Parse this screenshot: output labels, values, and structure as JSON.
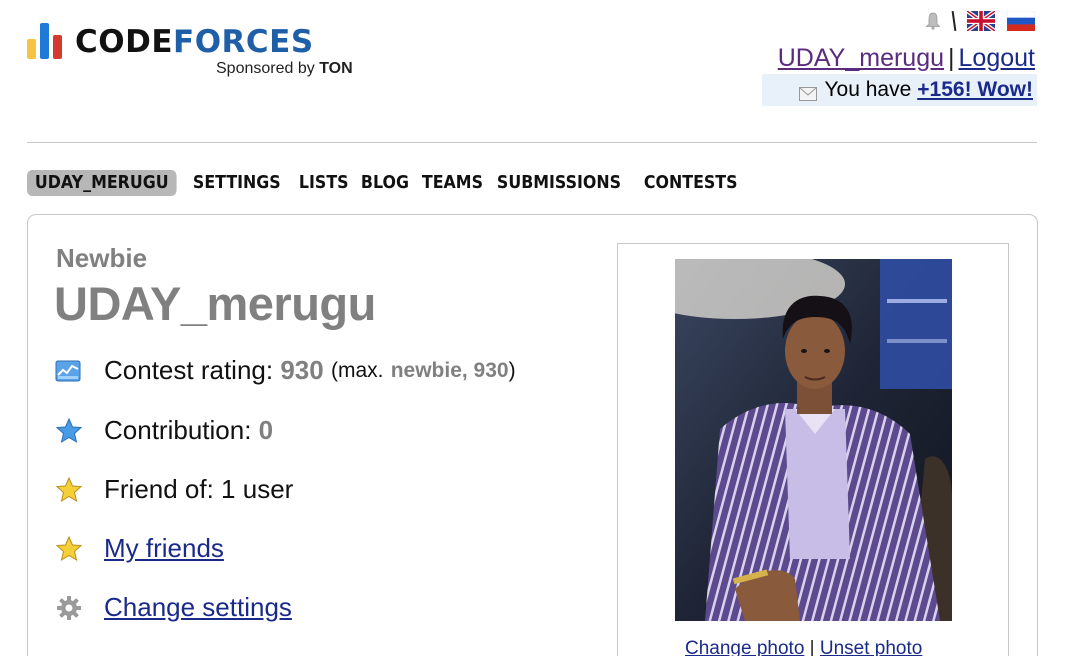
{
  "logo": {
    "title_code": "CODE",
    "title_forces": "FORCES",
    "sponsored_prefix": "Sponsored by",
    "sponsored_brand": "TON"
  },
  "header": {
    "username": "UDAY_merugu",
    "separator": "|",
    "logout": "Logout",
    "message_prefix": "You have",
    "message_count": "+156! Wow!"
  },
  "tabs": [
    {
      "label": "UDAY_MERUGU",
      "active": true
    },
    {
      "label": "SETTINGS",
      "active": false
    },
    {
      "label": "LISTS",
      "active": false
    },
    {
      "label": "BLOG",
      "active": false
    },
    {
      "label": "TEAMS",
      "active": false
    },
    {
      "label": "SUBMISSIONS",
      "active": false
    },
    {
      "label": "CONTESTS",
      "active": false
    }
  ],
  "profile": {
    "rank": "Newbie",
    "handle": "UDAY_merugu",
    "rating_label": "Contest rating:",
    "rating_value": "930",
    "rating_max_prefix": "(max.",
    "rating_max_rank": "newbie, 930",
    "rating_max_suffix": ")",
    "contribution_label": "Contribution:",
    "contribution_value": "0",
    "friend_of": "Friend of: 1 user",
    "my_friends": "My friends",
    "change_settings": "Change settings"
  },
  "photo": {
    "change_photo": "Change photo",
    "separator": "|",
    "unset_photo": "Unset photo"
  },
  "icons": {
    "notification": "bell-icon",
    "flag_en": "uk-flag-icon",
    "flag_ru": "russia-flag-icon",
    "message": "envelope-icon",
    "rating": "rating-chart-icon",
    "contribution": "blue-star-icon",
    "friend_of": "gold-star-icon",
    "my_friends": "gold-star-icon",
    "settings": "gear-icon"
  },
  "colors": {
    "rank_gray": "#808080",
    "link_blue": "#1a2a8a",
    "visited_purple": "#5a2b7e",
    "brand_blue": "#1f5fa8",
    "logo_yellow": "#f6c342",
    "logo_blue": "#1e7ad6",
    "logo_red": "#d43a30"
  }
}
